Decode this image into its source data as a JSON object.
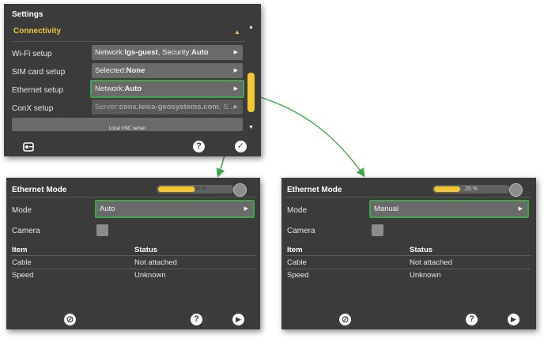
{
  "settings": {
    "title": "Settings",
    "section": "Connectivity",
    "rows": [
      {
        "label": "Wi-Fi setup",
        "prefix": "Network:",
        "bold": "lgs-guest",
        "rest": ", Security:",
        "bold2": "Auto"
      },
      {
        "label": "SIM card setup",
        "prefix": "Selected:",
        "bold": "None",
        "rest": "",
        "bold2": ""
      },
      {
        "label": "Ethernet setup",
        "prefix": "Network:",
        "bold": "Auto",
        "rest": "",
        "bold2": ""
      },
      {
        "label": "ConX setup",
        "prefix": "Server:",
        "bold": "conx.leica-geosystems.com",
        "rest": ", S...",
        "bold2": ""
      }
    ],
    "vnc_label": "Local VNC server",
    "icons": [
      "home-icon",
      "help-icon",
      "check-icon"
    ]
  },
  "panels": [
    {
      "title": "Ethernet Mode",
      "progress_pct": "50 %",
      "progress_value": 0.5,
      "mode_label": "Mode",
      "mode_value": "Auto",
      "camera_label": "Camera",
      "table_headers": [
        "Item",
        "Status"
      ],
      "table_rows": [
        [
          "Cable",
          "Not attached"
        ],
        [
          "Speed",
          "Unknown"
        ]
      ]
    },
    {
      "title": "Ethernet Mode",
      "progress_pct": "25 %",
      "progress_value": 0.25,
      "mode_label": "Mode",
      "mode_value": "Manual",
      "camera_label": "Camera",
      "table_headers": [
        "Item",
        "Status"
      ],
      "table_rows": [
        [
          "Cable",
          "Not attached"
        ],
        [
          "Speed",
          "Unknown"
        ]
      ]
    }
  ],
  "colors": {
    "panel": "#3b3b3b",
    "accent_yellow": "#f5c82f",
    "highlight_green": "#3fa64b",
    "field": "#6a6a6a"
  }
}
